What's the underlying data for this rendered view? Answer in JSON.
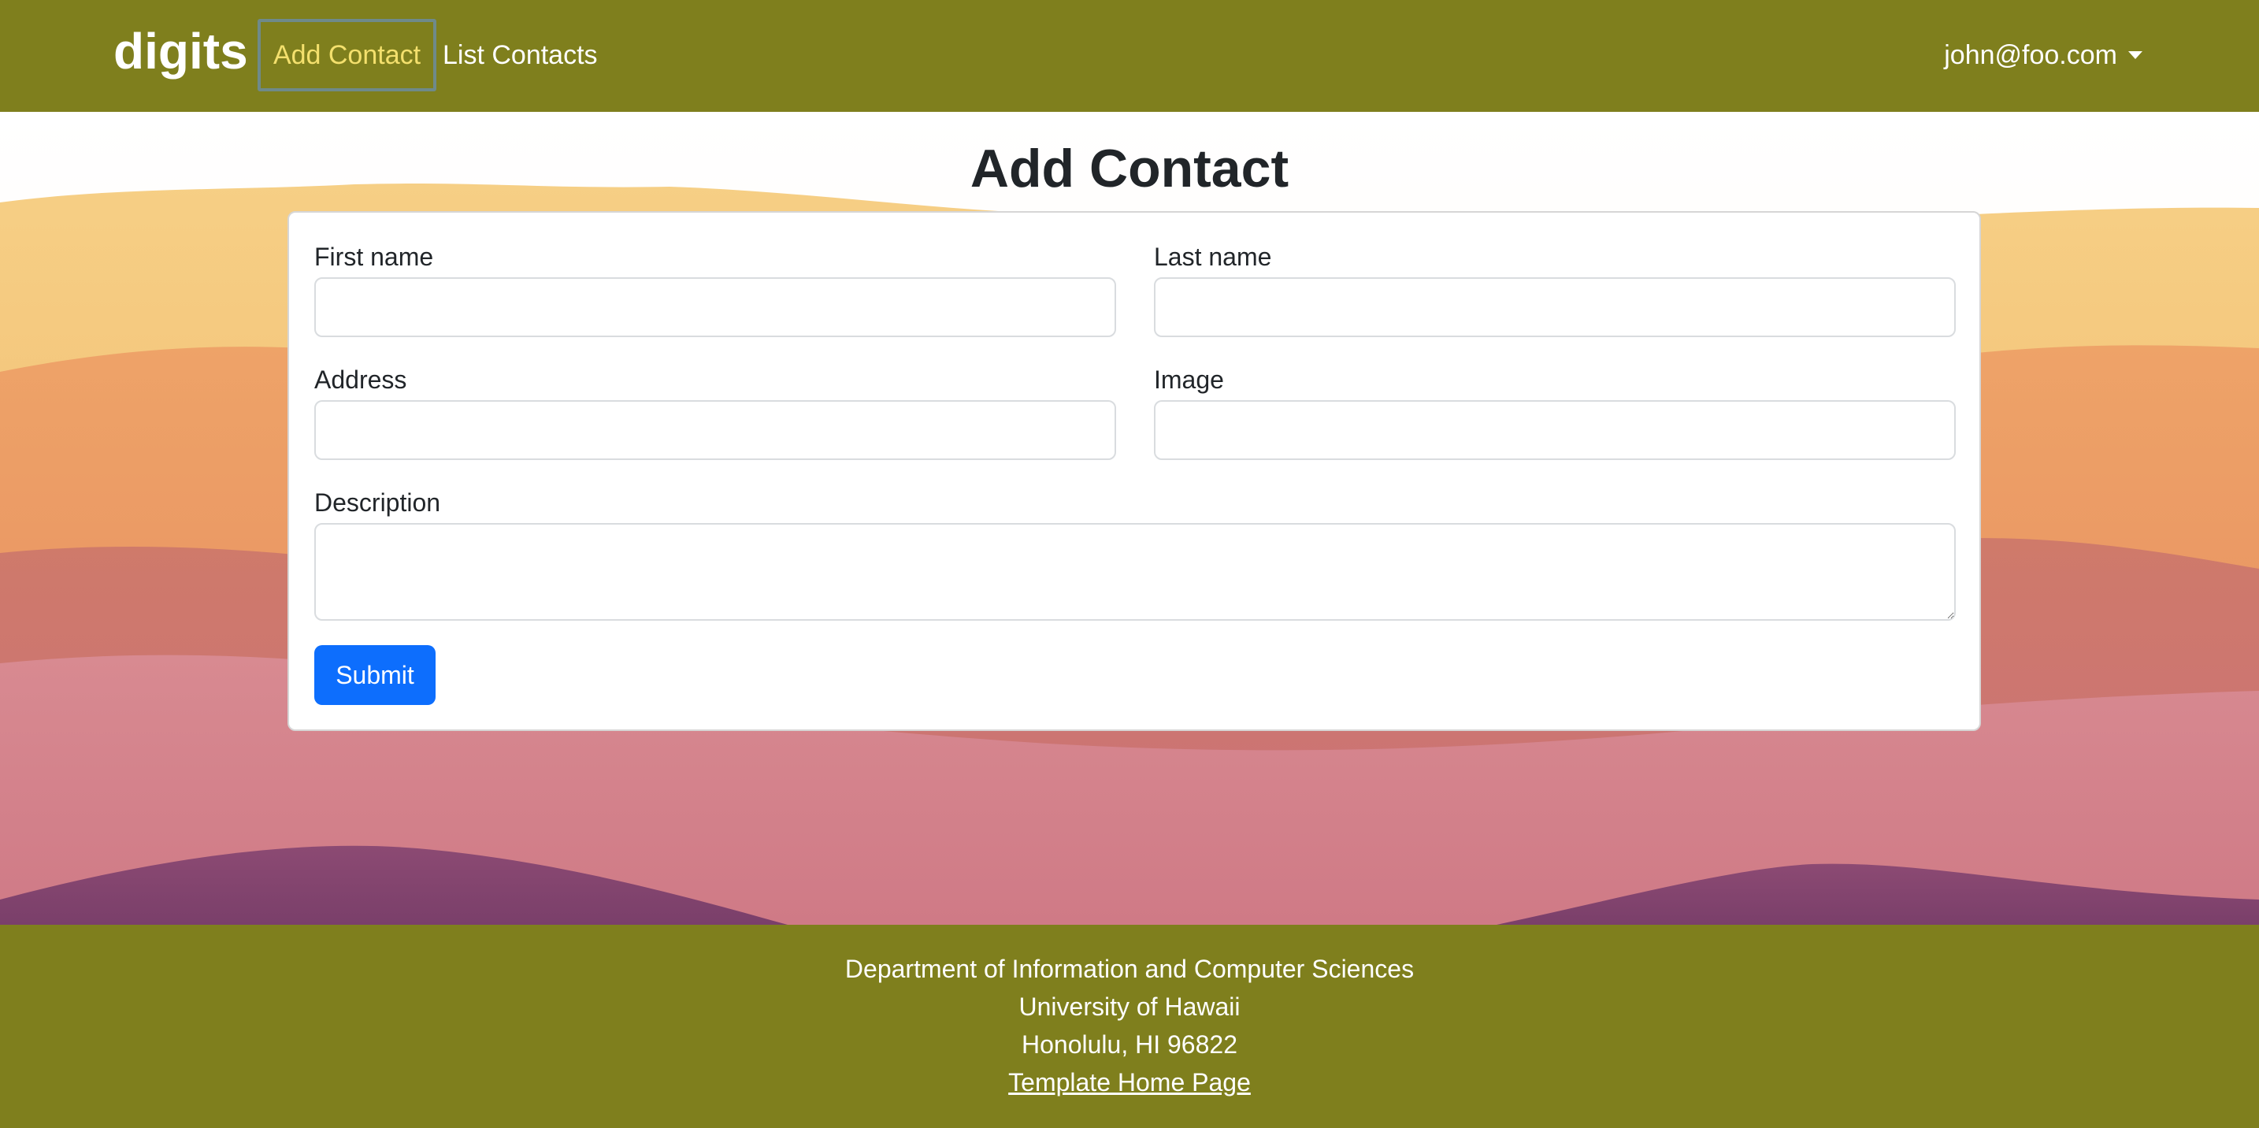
{
  "navbar": {
    "brand": "digits",
    "links": [
      {
        "label": "Add Contact",
        "active": true
      },
      {
        "label": "List Contacts",
        "active": false
      }
    ],
    "user_menu": "john@foo.com",
    "background_color": "#7f7f1d",
    "active_link_color": "#f4e06d"
  },
  "page": {
    "title": "Add Contact"
  },
  "form": {
    "fields": {
      "first_name": {
        "label": "First name",
        "value": ""
      },
      "last_name": {
        "label": "Last name",
        "value": ""
      },
      "address": {
        "label": "Address",
        "value": ""
      },
      "image": {
        "label": "Image",
        "value": ""
      },
      "description": {
        "label": "Description",
        "value": ""
      }
    },
    "submit_label": "Submit",
    "submit_color": "#0d6efd"
  },
  "footer": {
    "lines": [
      "Department of Information and Computer Sciences",
      "University of Hawaii",
      "Honolulu, HI 96822"
    ],
    "link_label": "Template Home Page",
    "background_color": "#7f7f1d"
  }
}
